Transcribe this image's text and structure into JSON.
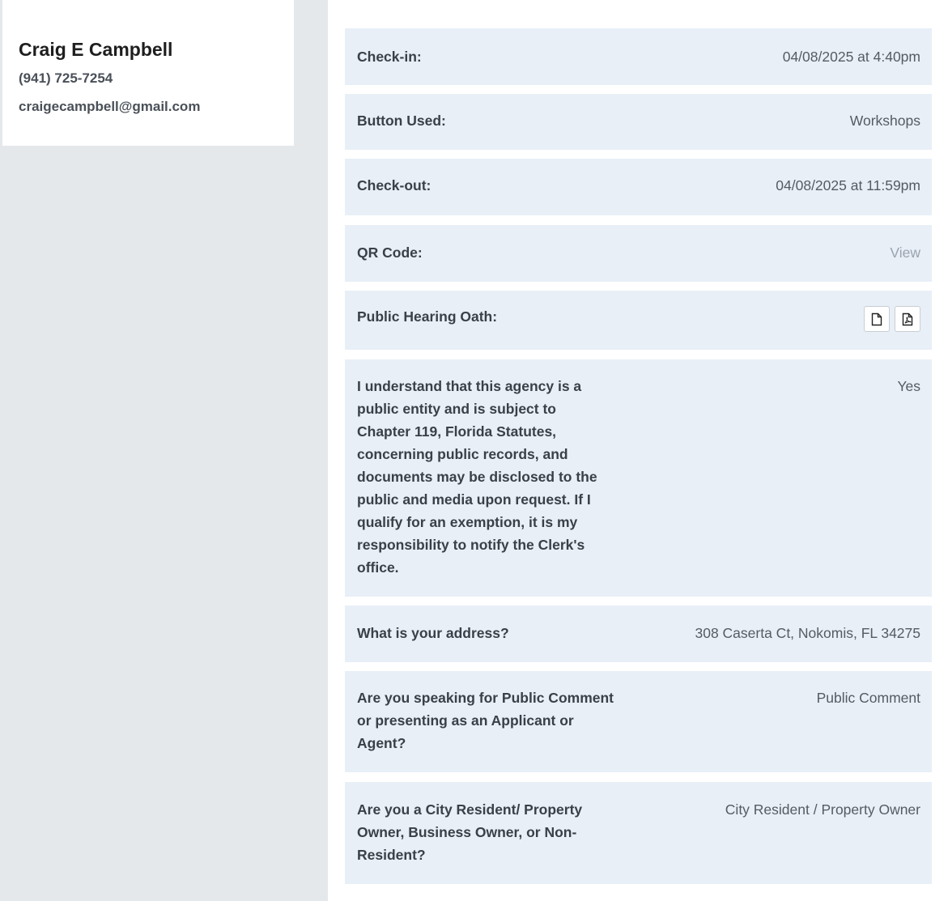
{
  "contact": {
    "name": "Craig E Campbell",
    "phone": "(941) 725-7254",
    "email": "craigecampbell@gmail.com"
  },
  "details": {
    "checkin": {
      "label": "Check-in:",
      "value": "04/08/2025 at 4:40pm"
    },
    "button_used": {
      "label": "Button Used:",
      "value": "Workshops"
    },
    "checkout": {
      "label": "Check-out:",
      "value": "04/08/2025 at 11:59pm"
    },
    "qr_code": {
      "label": "QR Code:",
      "value": "View"
    },
    "oath": {
      "label": "Public Hearing Oath:",
      "icons": [
        "file-icon",
        "pdf-icon"
      ]
    },
    "records": {
      "lines": [
        "I understand that this agency is a",
        "public entity and is subject to",
        "Chapter 119, Florida Statutes,",
        "concerning public records, and",
        "documents may be disclosed to the",
        "public and media upon request. If I",
        "qualify for an exemption, it is my",
        "responsibility to notify the Clerk's",
        "office."
      ],
      "value": "Yes"
    },
    "address": {
      "label": "What is your address?",
      "value": "308 Caserta Ct, Nokomis, FL 34275"
    },
    "speaking": {
      "lines": [
        "Are you speaking for Public Comment",
        "or presenting as an Applicant or",
        "Agent?"
      ],
      "value": "Public Comment"
    },
    "resident": {
      "lines": [
        "Are you a City Resident/ Property",
        "Owner, Business Owner, or Non-",
        "Resident?"
      ],
      "value": "City Resident / Property Owner"
    }
  }
}
